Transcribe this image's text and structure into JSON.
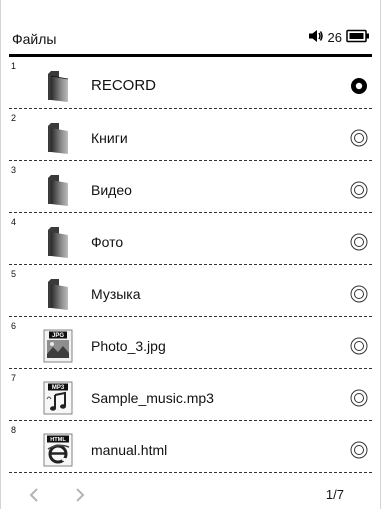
{
  "header": {
    "title": "Файлы",
    "volume_icon": "speaker-icon",
    "volume_value": "26",
    "battery_icon": "battery-icon"
  },
  "files": [
    {
      "index": "1",
      "name": "RECORD",
      "type": "folder",
      "icon": "folder-icon",
      "selected": true
    },
    {
      "index": "2",
      "name": "Книги",
      "type": "folder",
      "icon": "folder-icon",
      "selected": false
    },
    {
      "index": "3",
      "name": "Видео",
      "type": "folder",
      "icon": "folder-icon",
      "selected": false
    },
    {
      "index": "4",
      "name": "Фото",
      "type": "folder",
      "icon": "folder-icon",
      "selected": false
    },
    {
      "index": "5",
      "name": "Музыка",
      "type": "folder",
      "icon": "folder-icon",
      "selected": false
    },
    {
      "index": "6",
      "name": "Photo_3.jpg",
      "type": "jpg",
      "icon": "jpg-file-icon",
      "badge": "JPG",
      "selected": false
    },
    {
      "index": "7",
      "name": "Sample_music.mp3",
      "type": "mp3",
      "icon": "mp3-file-icon",
      "badge": "MP3",
      "selected": false
    },
    {
      "index": "8",
      "name": "manual.html",
      "type": "html",
      "icon": "html-file-icon",
      "badge": "HTML",
      "selected": false
    }
  ],
  "footer": {
    "prev_icon": "chevron-left-icon",
    "next_icon": "chevron-right-icon",
    "page_indicator": "1/7"
  }
}
